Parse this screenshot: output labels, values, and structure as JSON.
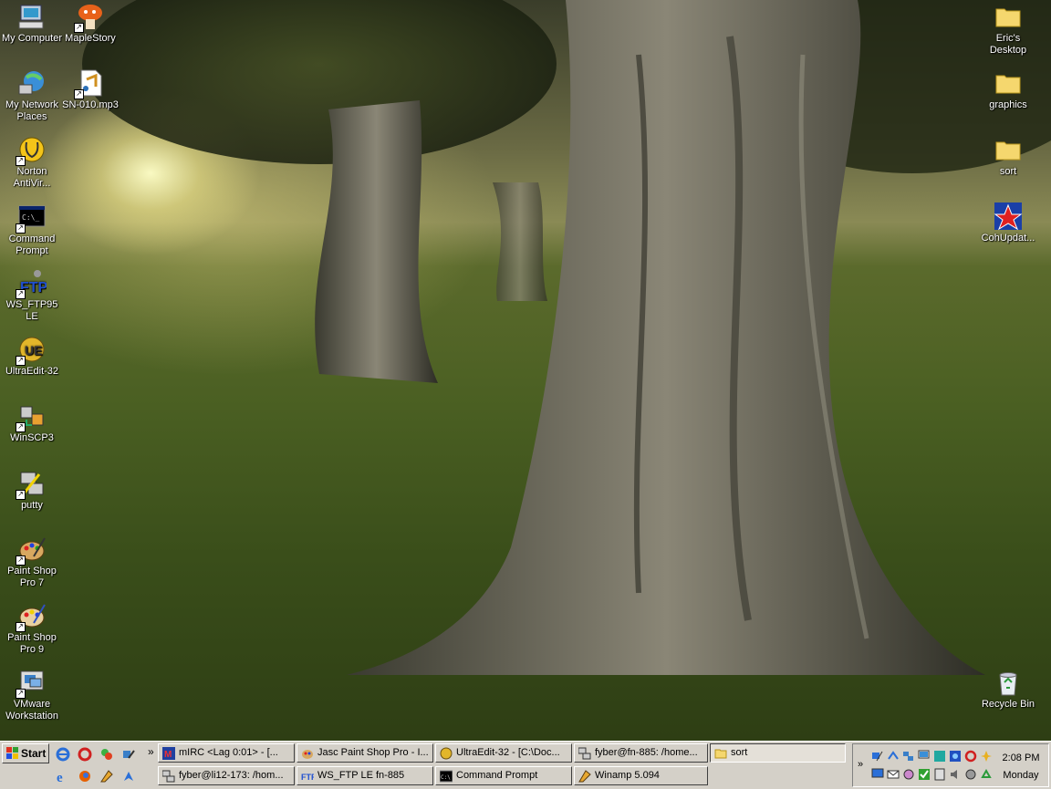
{
  "desktop": {
    "left_icons": [
      {
        "label": "My Computer",
        "icon": "my-computer-icon"
      },
      {
        "label": "MapleStory",
        "icon": "maplestory-icon"
      },
      {
        "label": "My Network\nPlaces",
        "icon": "network-places-icon"
      },
      {
        "label": "SN-010.mp3",
        "icon": "mp3-file-icon"
      },
      {
        "label": "Norton\nAntiVir...",
        "icon": "norton-antivirus-icon"
      },
      {
        "label": "Command\nPrompt",
        "icon": "command-prompt-icon"
      },
      {
        "label": "WS_FTP95\nLE",
        "icon": "ws-ftp-icon"
      },
      {
        "label": "UltraEdit-32",
        "icon": "ultraedit-icon"
      },
      {
        "label": "WinSCP3",
        "icon": "winscp-icon"
      },
      {
        "label": "putty",
        "icon": "putty-icon"
      },
      {
        "label": "Paint Shop\nPro 7",
        "icon": "paint-shop-pro-7-icon"
      },
      {
        "label": "Paint Shop\nPro 9",
        "icon": "paint-shop-pro-9-icon"
      },
      {
        "label": "VMware\nWorkstation",
        "icon": "vmware-icon"
      }
    ],
    "right_icons": [
      {
        "label": "Eric's\nDesktop",
        "icon": "folder-icon"
      },
      {
        "label": "graphics",
        "icon": "folder-icon"
      },
      {
        "label": "sort",
        "icon": "folder-icon"
      },
      {
        "label": "CohUpdat...",
        "icon": "coh-updater-icon"
      },
      {
        "label": "Recycle Bin",
        "icon": "recycle-bin-icon"
      }
    ]
  },
  "taskbar": {
    "start_label": "Start",
    "chevron": "»",
    "windows": [
      {
        "label": "mIRC <Lag 0:01> - [...",
        "icon": "mirc-icon"
      },
      {
        "label": "Jasc Paint Shop Pro - I...",
        "icon": "paint-shop-icon"
      },
      {
        "label": "UltraEdit-32 - [C:\\Doc...",
        "icon": "ultraedit-icon"
      },
      {
        "label": "fyber@fn-885: /home...",
        "icon": "putty-icon"
      },
      {
        "label": "sort",
        "icon": "folder-icon"
      },
      {
        "label": "fyber@li12-173: /hom...",
        "icon": "putty-icon"
      },
      {
        "label": "WS_FTP LE fn-885",
        "icon": "ws-ftp-icon"
      },
      {
        "label": "Command Prompt",
        "icon": "command-prompt-icon"
      },
      {
        "label": "Winamp 5.094",
        "icon": "winamp-icon"
      }
    ],
    "clock": {
      "time": "2:08 PM",
      "day": "Monday"
    }
  },
  "colors": {
    "taskbar": "#d4d0c8",
    "folder": "#f5d76e",
    "desktop_text": "#ffffff"
  }
}
